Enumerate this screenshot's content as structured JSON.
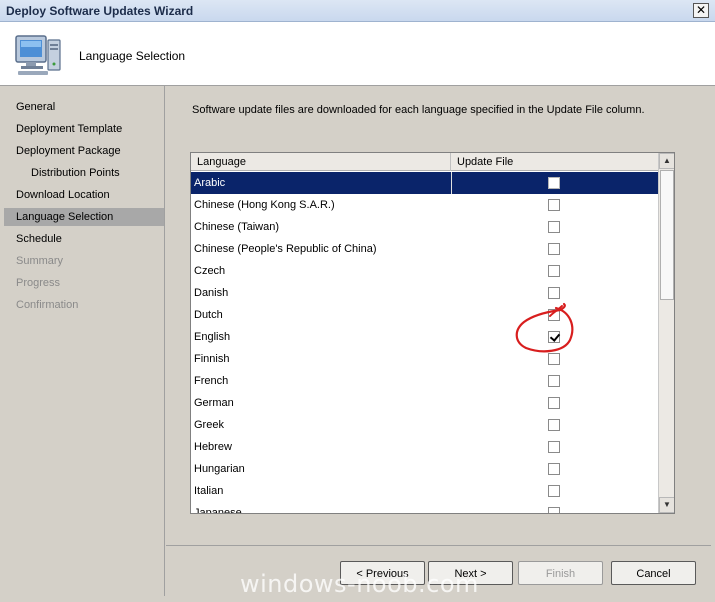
{
  "window": {
    "title": "Deploy Software Updates Wizard",
    "close_glyph": "✕"
  },
  "header": {
    "title": "Language Selection",
    "icon": "computer-icon"
  },
  "sidebar": {
    "items": [
      {
        "label": "General",
        "state": "normal",
        "sub": false
      },
      {
        "label": "Deployment Template",
        "state": "normal",
        "sub": false
      },
      {
        "label": "Deployment Package",
        "state": "normal",
        "sub": false
      },
      {
        "label": "Distribution Points",
        "state": "normal",
        "sub": true
      },
      {
        "label": "Download Location",
        "state": "normal",
        "sub": false
      },
      {
        "label": "Language Selection",
        "state": "active",
        "sub": false
      },
      {
        "label": "Schedule",
        "state": "normal",
        "sub": false
      },
      {
        "label": "Summary",
        "state": "disabled",
        "sub": false
      },
      {
        "label": "Progress",
        "state": "disabled",
        "sub": false
      },
      {
        "label": "Confirmation",
        "state": "disabled",
        "sub": false
      }
    ]
  },
  "content": {
    "intro": "Software update files are downloaded for each language specified in the Update File column.",
    "columns": {
      "language": "Language",
      "update_file": "Update File"
    },
    "rows": [
      {
        "language": "Arabic",
        "checked": false,
        "selected": true
      },
      {
        "language": "Chinese (Hong Kong S.A.R.)",
        "checked": false,
        "selected": false
      },
      {
        "language": "Chinese (Taiwan)",
        "checked": false,
        "selected": false
      },
      {
        "language": "Chinese (People's Republic of China)",
        "checked": false,
        "selected": false
      },
      {
        "language": "Czech",
        "checked": false,
        "selected": false
      },
      {
        "language": "Danish",
        "checked": false,
        "selected": false
      },
      {
        "language": "Dutch",
        "checked": false,
        "selected": false
      },
      {
        "language": "English",
        "checked": true,
        "selected": false
      },
      {
        "language": "Finnish",
        "checked": false,
        "selected": false
      },
      {
        "language": "French",
        "checked": false,
        "selected": false
      },
      {
        "language": "German",
        "checked": false,
        "selected": false
      },
      {
        "language": "Greek",
        "checked": false,
        "selected": false
      },
      {
        "language": "Hebrew",
        "checked": false,
        "selected": false
      },
      {
        "language": "Hungarian",
        "checked": false,
        "selected": false
      },
      {
        "language": "Italian",
        "checked": false,
        "selected": false
      },
      {
        "language": "Japanese",
        "checked": false,
        "selected": false
      }
    ]
  },
  "buttons": {
    "previous": "< Previous",
    "next": "Next >",
    "finish": "Finish",
    "cancel": "Cancel"
  },
  "watermark": "windows-noob.com",
  "colors": {
    "selection": "#0a246a",
    "active_nav": "#a8a8a8",
    "annotation": "#d81e1e"
  }
}
